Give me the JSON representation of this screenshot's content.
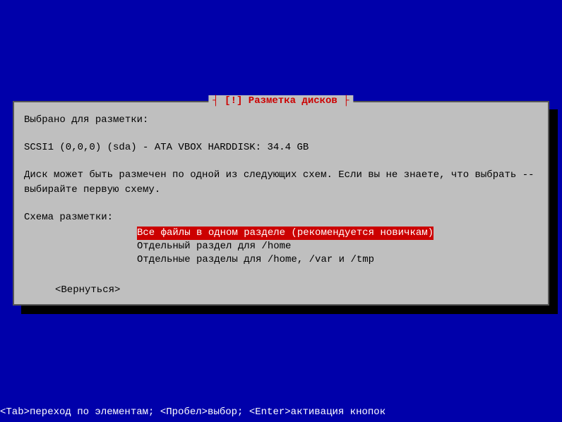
{
  "dialog": {
    "title_prefix": "┤ ",
    "title_icon": "[!]",
    "title_text": " Разметка дисков",
    "title_suffix": " ├",
    "intro_label": "Выбрано для разметки:",
    "disk_info": "SCSI1 (0,0,0) (sda) - ATA VBOX HARDDISK: 34.4 GB",
    "description_line1": "Диск может быть размечен по одной из следующих схем. Если вы не знаете, что выбрать --",
    "description_line2": "выбирайте первую схему.",
    "scheme_label": "Схема разметки:",
    "options": [
      {
        "label": "Все файлы в одном разделе (рекомендуется новичкам)",
        "selected": true
      },
      {
        "label": "Отдельный раздел для /home",
        "selected": false
      },
      {
        "label": "Отдельные разделы для /home, /var и /tmp",
        "selected": false
      }
    ],
    "back_button": "<Вернуться>"
  },
  "footer": {
    "text": "<Tab>переход по элементам; <Пробел>выбор; <Enter>активация кнопок"
  }
}
